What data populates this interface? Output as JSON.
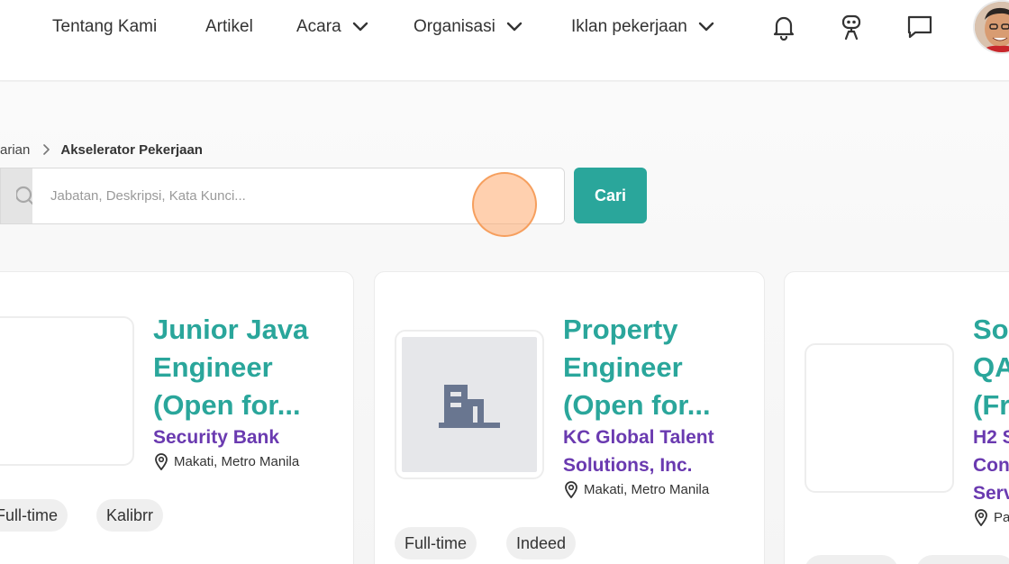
{
  "nav": {
    "items": [
      {
        "label": "Tentang Kami",
        "has_dropdown": false
      },
      {
        "label": "Artikel",
        "has_dropdown": false
      },
      {
        "label": "Acara",
        "has_dropdown": true
      },
      {
        "label": "Organisasi",
        "has_dropdown": true
      },
      {
        "label": "Iklan pekerjaan",
        "has_dropdown": true
      }
    ],
    "icons": [
      "bell-icon",
      "robot-icon",
      "chat-icon"
    ]
  },
  "breadcrumb": {
    "parent": "arian",
    "current": "Akselerator Pekerjaan"
  },
  "search": {
    "value": "",
    "placeholder": "Jabatan, Deskripsi, Kata Kunci...",
    "button_label": "Cari"
  },
  "colors": {
    "accent": "#2aa69b",
    "company": "#6a3ab0",
    "tag_bg": "#efefef"
  },
  "jobs": [
    {
      "title_lines": [
        "Junior Java",
        "Engineer",
        "(Open for..."
      ],
      "company_lines": [
        "Security Bank"
      ],
      "location": "Makati, Metro Manila",
      "tags": [
        "Full-time",
        "Kalibrr"
      ],
      "logo": "blank"
    },
    {
      "title_lines": [
        "Property",
        "Engineer",
        "(Open for..."
      ],
      "company_lines": [
        "KC Global Talent",
        "Solutions, Inc."
      ],
      "location": "Makati, Metro Manila",
      "tags": [
        "Full-time",
        "Indeed"
      ],
      "logo": "building-icon"
    },
    {
      "title_lines": [
        "So",
        "QA",
        "(Fr"
      ],
      "company_lines": [
        "H2 S",
        "Con",
        "Serv"
      ],
      "location": "Pa",
      "tags": [],
      "logo": "blank"
    }
  ]
}
